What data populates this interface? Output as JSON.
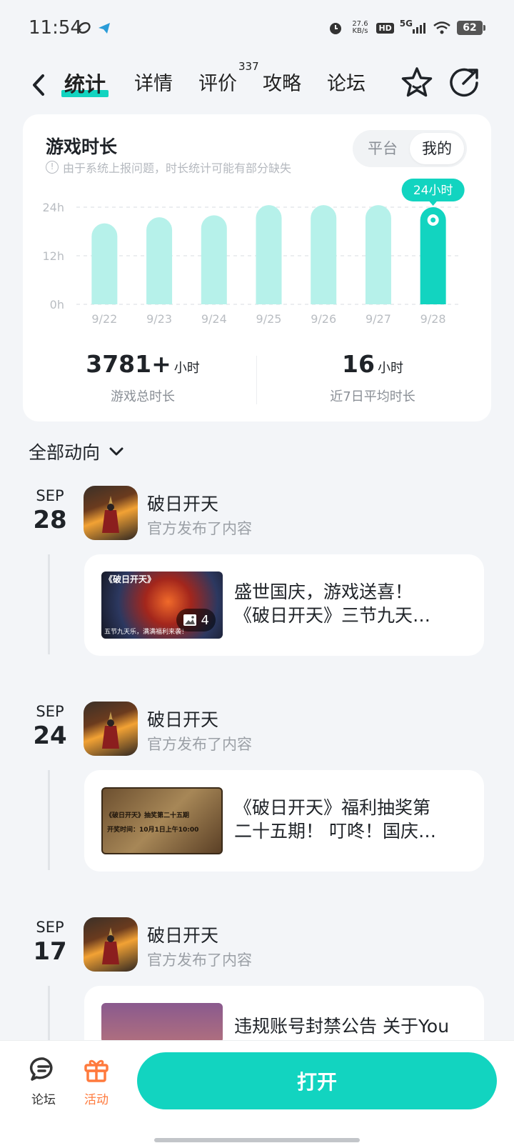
{
  "status_bar": {
    "time": "11:54",
    "net_speed_value": "27.6",
    "net_speed_unit": "KB/s",
    "network": "5G",
    "hd": "HD",
    "battery": "62"
  },
  "nav": {
    "tabs": [
      {
        "label": "统计",
        "active": true
      },
      {
        "label": "详情"
      },
      {
        "label": "评价",
        "badge": "337"
      },
      {
        "label": "攻略"
      },
      {
        "label": "论坛"
      }
    ],
    "icons": [
      "back-icon",
      "star-icon",
      "share-icon"
    ]
  },
  "stats": {
    "title": "游戏时长",
    "note": "由于系统上报问题，时长统计可能有部分缺失",
    "segment": {
      "options": [
        "平台",
        "我的"
      ],
      "selected": "我的"
    },
    "total_value": "3781+",
    "total_unit": "小时",
    "total_label": "游戏总时长",
    "avg_value": "16",
    "avg_unit": "小时",
    "avg_label": "近7日平均时长"
  },
  "chart_data": {
    "type": "bar",
    "categories": [
      "9/22",
      "9/23",
      "9/24",
      "9/25",
      "9/26",
      "9/27",
      "9/28"
    ],
    "values": [
      20,
      21.5,
      22,
      24.5,
      24.5,
      24.5,
      24
    ],
    "y_ticks": [
      "0h",
      "12h",
      "24h"
    ],
    "ylim": [
      0,
      24
    ],
    "grid": true,
    "highlight_index": 6,
    "highlight_label": "24小时",
    "colors": {
      "bar": "#b6f1ea",
      "highlight": "#12d4c0"
    }
  },
  "feed": {
    "filter_label": "全部动向",
    "items": [
      {
        "month": "SEP",
        "day": "28",
        "game": "破日开天",
        "sub": "官方发布了内容",
        "title_line1": "盛世国庆，游戏送喜！",
        "title_line2": "《破日开天》三节九天…",
        "image_count": "4",
        "thumb_text1": "《破日开天》",
        "thumb_text2": "五节九天乐，满满福利来袭！"
      },
      {
        "month": "SEP",
        "day": "24",
        "game": "破日开天",
        "sub": "官方发布了内容",
        "title_line1": "《破日开天》福利抽奖第",
        "title_line2": "二十五期！ 叮咚！国庆…",
        "thumb_text1": "《破日开天》抽奖第二十五期",
        "thumb_text2": "开奖时间：10月1日上午10:00"
      },
      {
        "month": "SEP",
        "day": "17",
        "game": "破日开天",
        "sub": "官方发布了内容",
        "title_line1": "违规账号封禁公告 关于You",
        "title_line2": ""
      }
    ]
  },
  "bottom": {
    "forum_label": "论坛",
    "activity_label": "活动",
    "open_label": "打开",
    "accent": "#12d4c0",
    "activity_color": "#ff7a3d"
  }
}
